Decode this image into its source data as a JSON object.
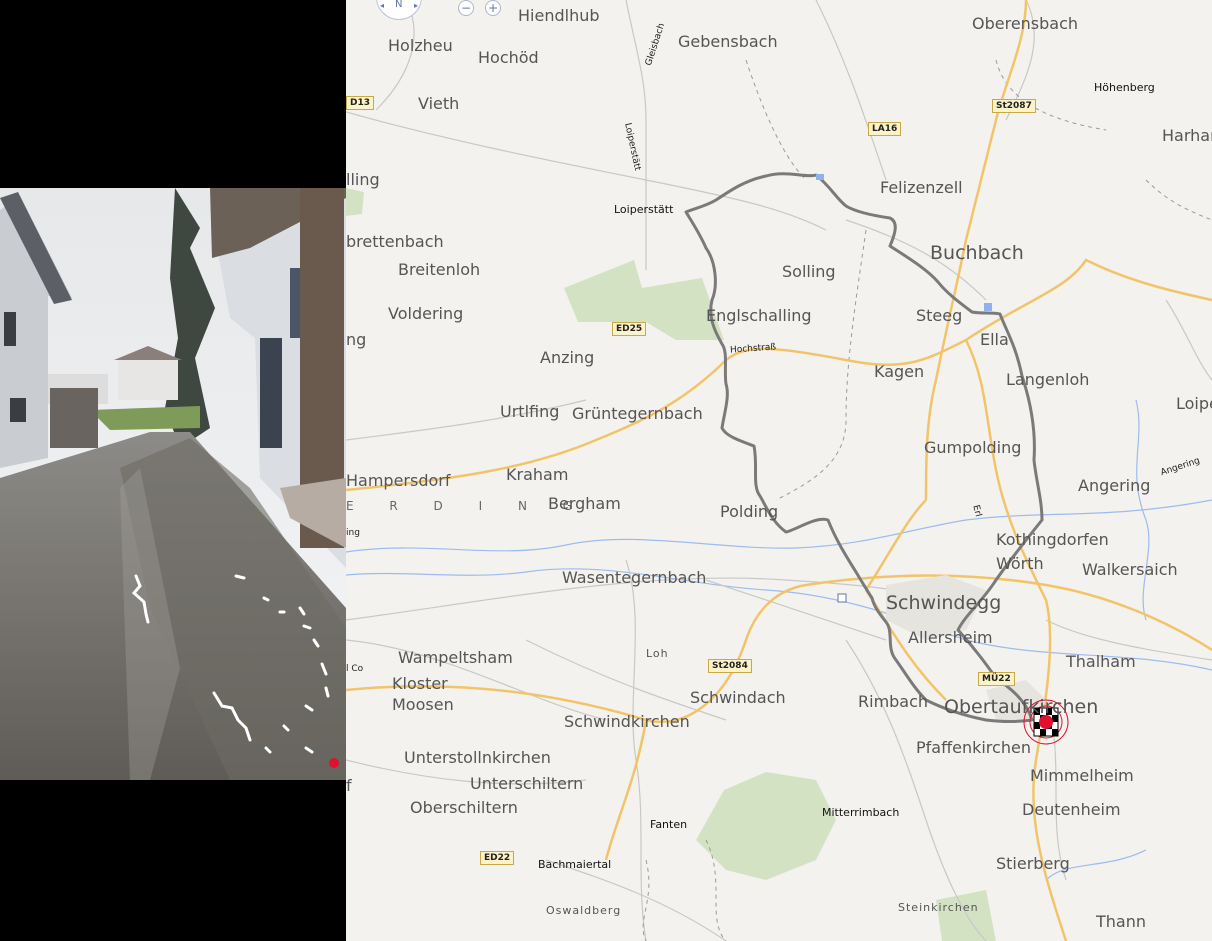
{
  "map": {
    "controls": {
      "north": "N",
      "zoom_out": "−",
      "zoom_in": "+"
    },
    "places": [
      {
        "id": "hiendlhub",
        "label": "Hiendlhub",
        "style": "normal"
      },
      {
        "id": "holzheu",
        "label": "Holzheu",
        "style": "normal"
      },
      {
        "id": "hochoed",
        "label": "Hochöd",
        "style": "normal"
      },
      {
        "id": "gebensbach",
        "label": "Gebensbach",
        "style": "normal"
      },
      {
        "id": "oberensbach",
        "label": "Oberensbach",
        "style": "normal"
      },
      {
        "id": "vieth",
        "label": "Vieth",
        "style": "normal"
      },
      {
        "id": "hoehenberg",
        "label": "Höhenberg",
        "style": "small"
      },
      {
        "id": "harhan",
        "label": "Harhan",
        "style": "normal"
      },
      {
        "id": "felizenzell",
        "label": "Felizenzell",
        "style": "normal"
      },
      {
        "id": "loiperstaett",
        "label": "Loiperstätt",
        "style": "small"
      },
      {
        "id": "lling",
        "label": "lling",
        "style": "normal"
      },
      {
        "id": "brettenbach",
        "label": "brettenbach",
        "style": "normal"
      },
      {
        "id": "breitenloh",
        "label": "Breitenloh",
        "style": "normal"
      },
      {
        "id": "buchbach",
        "label": "Buchbach",
        "style": "big"
      },
      {
        "id": "solling",
        "label": "Solling",
        "style": "normal"
      },
      {
        "id": "voldering",
        "label": "Voldering",
        "style": "normal"
      },
      {
        "id": "englschalling",
        "label": "Englschalling",
        "style": "normal"
      },
      {
        "id": "steeg",
        "label": "Steeg",
        "style": "normal"
      },
      {
        "id": "ng",
        "label": "ng",
        "style": "normal"
      },
      {
        "id": "ella",
        "label": "Ella",
        "style": "normal"
      },
      {
        "id": "anzing",
        "label": "Anzing",
        "style": "normal"
      },
      {
        "id": "kagen",
        "label": "Kagen",
        "style": "normal"
      },
      {
        "id": "langenloh",
        "label": "Langenloh",
        "style": "normal"
      },
      {
        "id": "loipe",
        "label": "Loipe",
        "style": "normal"
      },
      {
        "id": "urtlfing",
        "label": "Urtlfing",
        "style": "normal"
      },
      {
        "id": "gruentegernbach",
        "label": "Grüntegernbach",
        "style": "normal"
      },
      {
        "id": "gumpolding",
        "label": "Gumpolding",
        "style": "normal"
      },
      {
        "id": "kraham",
        "label": "Kraham",
        "style": "normal"
      },
      {
        "id": "hampersdorf",
        "label": "Hampersdorf",
        "style": "normal"
      },
      {
        "id": "angering",
        "label": "Angering",
        "style": "normal"
      },
      {
        "id": "erding",
        "label": "E R D I N G",
        "style": "spaced"
      },
      {
        "id": "bergham",
        "label": "Bergham",
        "style": "normal"
      },
      {
        "id": "polding",
        "label": "Polding",
        "style": "normal"
      },
      {
        "id": "kothingdorfen",
        "label": "Kothingdorfen",
        "style": "normal"
      },
      {
        "id": "woerth",
        "label": "Wörth",
        "style": "normal"
      },
      {
        "id": "walkersaich",
        "label": "Walkersaich",
        "style": "normal"
      },
      {
        "id": "wasentegernbach",
        "label": "Wasentegernbach",
        "style": "normal"
      },
      {
        "id": "schwindegg",
        "label": "Schwindegg",
        "style": "big"
      },
      {
        "id": "allersheim",
        "label": "Allersheim",
        "style": "normal"
      },
      {
        "id": "loh",
        "label": "Loh",
        "style": "caps"
      },
      {
        "id": "wampeltsham",
        "label": "Wampeltsham",
        "style": "normal"
      },
      {
        "id": "thalham",
        "label": "Thalham",
        "style": "normal"
      },
      {
        "id": "kloster",
        "label": "Kloster",
        "style": "normal"
      },
      {
        "id": "moosen",
        "label": "Moosen",
        "style": "normal"
      },
      {
        "id": "schwindach",
        "label": "Schwindach",
        "style": "normal"
      },
      {
        "id": "rimbach",
        "label": "Rimbach",
        "style": "normal"
      },
      {
        "id": "obertaufkirchen",
        "label": "Obertaufkirchen",
        "style": "big"
      },
      {
        "id": "schwindkirchen",
        "label": "Schwindkirchen",
        "style": "normal"
      },
      {
        "id": "pfaffenkirchen",
        "label": "Pfaffenkirchen",
        "style": "normal"
      },
      {
        "id": "unterstollnkirchen",
        "label": "Unterstollnkirchen",
        "style": "normal"
      },
      {
        "id": "mimmelheim",
        "label": "Mimmelheim",
        "style": "normal"
      },
      {
        "id": "unterschiltern",
        "label": "Unterschiltern",
        "style": "normal"
      },
      {
        "id": "deutenheim",
        "label": "Deutenheim",
        "style": "normal"
      },
      {
        "id": "oberschiltern",
        "label": "Oberschiltern",
        "style": "normal"
      },
      {
        "id": "mitterrimbach",
        "label": "Mitterrimbach",
        "style": "small"
      },
      {
        "id": "fanten",
        "label": "Fanten",
        "style": "small"
      },
      {
        "id": "stierberg",
        "label": "Stierberg",
        "style": "normal"
      },
      {
        "id": "bachmaiertal",
        "label": "Bachmaiertal",
        "style": "small"
      },
      {
        "id": "oswaldberg",
        "label": "Oswaldberg",
        "style": "caps"
      },
      {
        "id": "steinkirchen",
        "label": "Steinkirchen",
        "style": "caps"
      },
      {
        "id": "thann",
        "label": "Thann",
        "style": "normal"
      },
      {
        "id": "f",
        "label": "f",
        "style": "normal"
      }
    ],
    "road_shields": [
      {
        "id": "d13",
        "label": "D13",
        "color": "yellow"
      },
      {
        "id": "la16",
        "label": "LA16",
        "color": "yellow"
      },
      {
        "id": "st2087",
        "label": "St2087",
        "color": "yellow"
      },
      {
        "id": "ed25",
        "label": "ED25",
        "color": "yellow"
      },
      {
        "id": "st2084",
        "label": "St2084",
        "color": "yellow"
      },
      {
        "id": "md22",
        "label": "MÜ22",
        "color": "yellow"
      },
      {
        "id": "ed22",
        "label": "ED22",
        "color": "yellow"
      }
    ],
    "street_labels": [
      {
        "id": "gleissbach",
        "label": "Gleisbach"
      },
      {
        "id": "loiperstaett-street",
        "label": "Loiperstätt"
      },
      {
        "id": "hochstrasse",
        "label": "Hochstraß"
      },
      {
        "id": "angering-street",
        "label": "Angering"
      },
      {
        "id": "erl",
        "label": "Erl"
      },
      {
        "id": "ing",
        "label": "ing"
      },
      {
        "id": "l-co",
        "label": "l Co"
      }
    ],
    "colors": {
      "background": "#f4f2ee",
      "road_major": "#f2c46a",
      "road_minor": "#c8c8c8",
      "route": "#7a7a7a",
      "forest": "#d4e2c4",
      "water": "#9dbbef",
      "marker": "#e0102e"
    }
  },
  "video": {
    "position_dot_color": "#e0102e"
  }
}
